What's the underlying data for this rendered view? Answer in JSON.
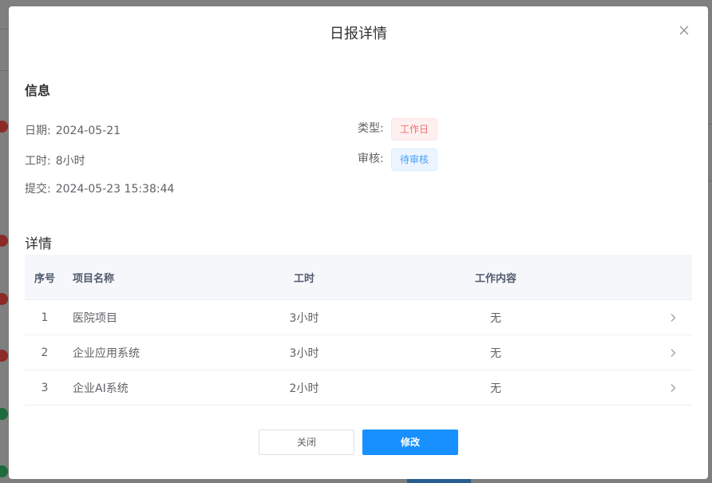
{
  "modal": {
    "title": "日报详情"
  },
  "info_section": {
    "title": "信息",
    "date_label": "日期:",
    "date_value": "2024-05-21",
    "hours_label": "工时:",
    "hours_value": "8小时",
    "submit_label": "提交:",
    "submit_value": "2024-05-23 15:38:44",
    "type_label": "类型:",
    "type_tag": "工作日",
    "review_label": "审核:",
    "review_tag": "待审核"
  },
  "detail_section": {
    "title": "详情",
    "columns": {
      "index": "序号",
      "project": "项目名称",
      "hours": "工时",
      "content": "工作内容"
    },
    "rows": [
      {
        "index": "1",
        "project": "医院项目",
        "hours": "3小时",
        "content": "无"
      },
      {
        "index": "2",
        "project": "企业应用系统",
        "hours": "3小时",
        "content": "无"
      },
      {
        "index": "3",
        "project": "企业AI系统",
        "hours": "2小时",
        "content": "无"
      }
    ]
  },
  "footer": {
    "close_label": "关闭",
    "edit_label": "修改"
  },
  "colors": {
    "primary": "#1890ff",
    "danger_tag": "#f56c6c",
    "info_tag": "#409eff"
  }
}
